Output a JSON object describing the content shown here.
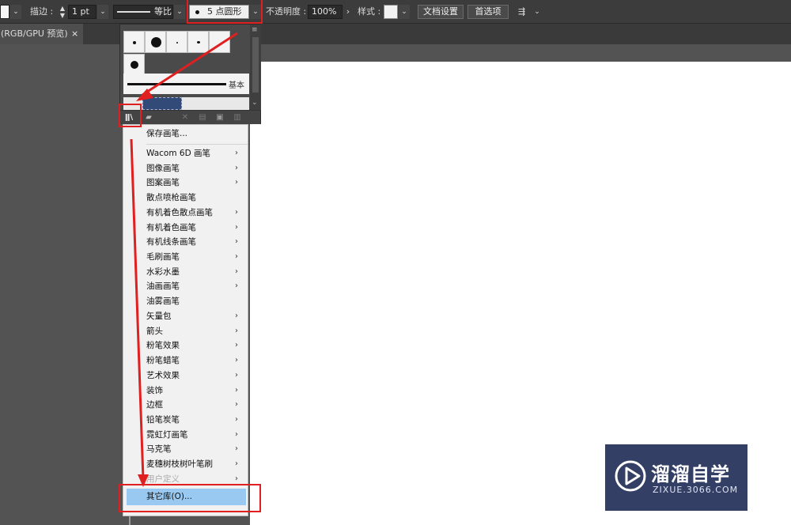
{
  "control_bar": {
    "stroke_label": "描边 :",
    "stroke_value": "1 pt",
    "profile_label": "等比",
    "brush_value": "5 点圆形",
    "opacity_label": "不透明度 :",
    "opacity_value": "100%",
    "style_label": "样式 :",
    "doc_setup": "文档设置",
    "preferences": "首选项"
  },
  "document_tab": {
    "title": "(RGB/GPU 预览)",
    "close": "×"
  },
  "brush_panel": {
    "basic_label": "基本"
  },
  "menu": {
    "save_brush": "保存画笔...",
    "items": [
      {
        "label": "Wacom 6D 画笔",
        "submenu": true
      },
      {
        "label": "图像画笔",
        "submenu": true
      },
      {
        "label": "图案画笔",
        "submenu": true
      },
      {
        "label": "散点喷枪画笔",
        "submenu": false
      },
      {
        "label": "有机着色散点画笔",
        "submenu": true
      },
      {
        "label": "有机着色画笔",
        "submenu": true
      },
      {
        "label": "有机线条画笔",
        "submenu": true
      },
      {
        "label": "毛刷画笔",
        "submenu": true
      },
      {
        "label": "水彩水墨",
        "submenu": true
      },
      {
        "label": "油画画笔",
        "submenu": true
      },
      {
        "label": "油雾画笔",
        "submenu": false
      },
      {
        "label": "矢量包",
        "submenu": true
      },
      {
        "label": "箭头",
        "submenu": true
      },
      {
        "label": "粉笔效果",
        "submenu": true
      },
      {
        "label": "粉笔蜡笔",
        "submenu": true
      },
      {
        "label": "艺术效果",
        "submenu": true
      },
      {
        "label": "装饰",
        "submenu": true
      },
      {
        "label": "边框",
        "submenu": true
      },
      {
        "label": "铅笔炭笔",
        "submenu": true
      },
      {
        "label": "霓虹灯画笔",
        "submenu": true
      },
      {
        "label": "马克笔",
        "submenu": true
      },
      {
        "label": "麦穗树枝树叶笔刷",
        "submenu": true
      },
      {
        "label": "用户定义",
        "submenu": true,
        "disabled": true
      }
    ],
    "other_library": "其它库(O)...",
    "submenu_arrow": "›"
  },
  "watermark": {
    "title": "溜溜自学",
    "url": "ZIXUE.3066.COM"
  },
  "colors": {
    "highlight": "#99c9f0",
    "annotation_red": "#e02020",
    "watermark_bg": "#333f64"
  }
}
